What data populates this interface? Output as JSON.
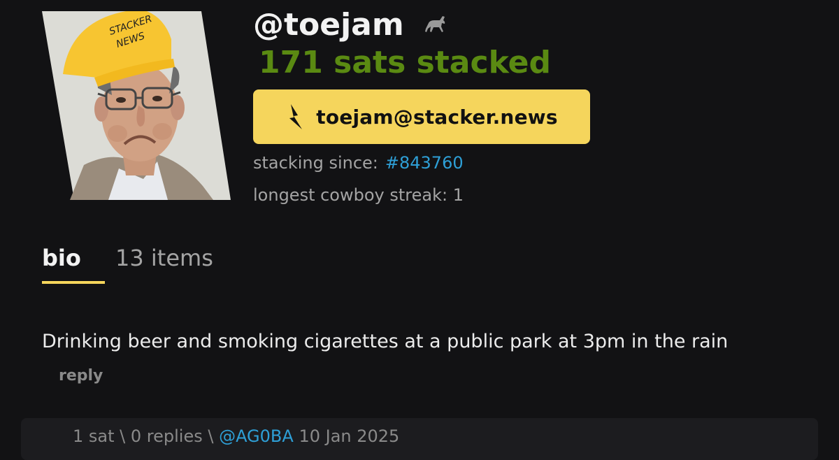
{
  "profile": {
    "username": "@toejam",
    "sats_stacked": "171 sats stacked",
    "lightning_address": "toejam@stacker.news",
    "stacking_since_label": "stacking since:",
    "stacking_since_value": "#843760",
    "cowboy_streak": "longest cowboy streak: 1",
    "avatar_hat_text_line1": "STACKER",
    "avatar_hat_text_line2": "NEWS"
  },
  "tabs": {
    "bio": "bio",
    "items": "13 items"
  },
  "bio": {
    "text": "Drinking beer and smoking cigarettes at a public park at 3pm in the rain",
    "reply_label": "reply"
  },
  "comment": {
    "meta_prefix": "1 sat \\ 0 replies \\",
    "author": "@AG0BA",
    "date": "10 Jan 2025"
  },
  "icons": {
    "horse": "horse-icon",
    "bolt": "lightning-bolt-icon"
  },
  "colors": {
    "background": "#121214",
    "accent_yellow": "#f5d55c",
    "sats_green": "#5a8a12",
    "link_blue": "#2e9fd6",
    "muted_text": "#a4a4a4"
  }
}
